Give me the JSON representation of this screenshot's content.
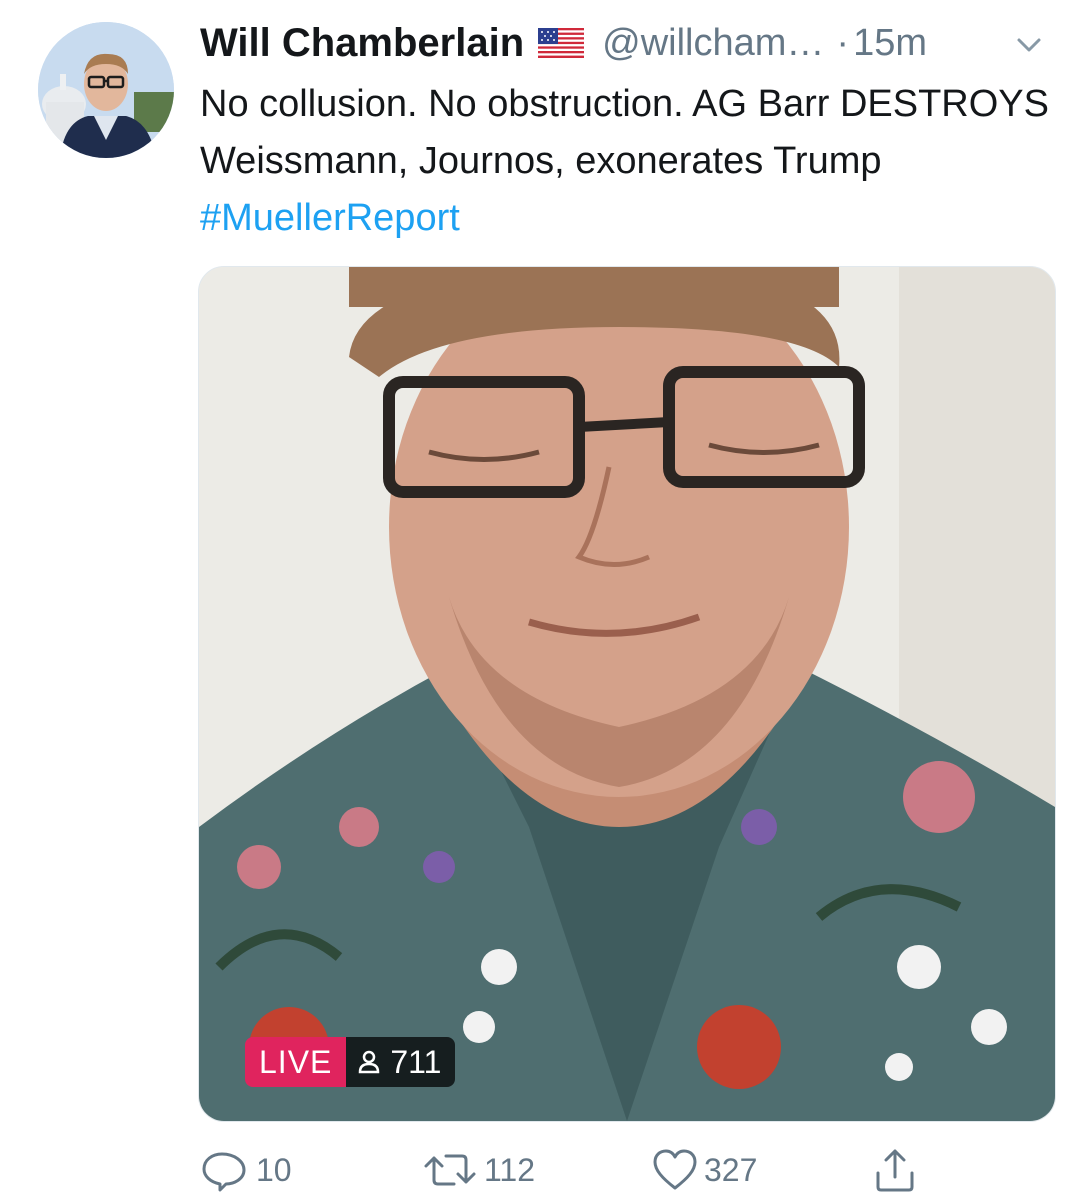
{
  "tweet": {
    "author_name": "Will Chamberlain",
    "author_flag_icon": "us-flag-icon",
    "handle": "@willcham…",
    "separator": "·",
    "timestamp": "15m",
    "text_before_hashtag": "No collusion. No obstruction. AG Barr DESTROYS Weissmann, Journos, exonerates Trump ",
    "hashtag": "#MuellerReport",
    "hashtag_color": "#1da1f2"
  },
  "media": {
    "live_label": "LIVE",
    "viewer_count": "711",
    "live_color": "#e0245e"
  },
  "actions": {
    "reply_count": "10",
    "retweet_count": "112",
    "like_count": "327",
    "icons": [
      "reply-icon",
      "retweet-icon",
      "like-icon",
      "share-icon"
    ]
  }
}
